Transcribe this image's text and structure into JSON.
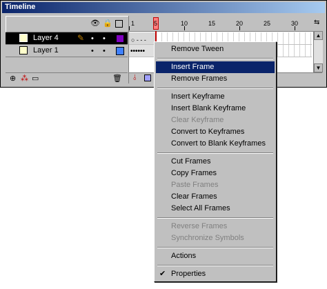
{
  "window": {
    "title": "Timeline"
  },
  "layers": [
    {
      "name": "Layer 4",
      "selected": true,
      "color": "#8000c0"
    },
    {
      "name": "Layer 1",
      "selected": false,
      "color": "#4080ff"
    }
  ],
  "ruler": {
    "labels": [
      "1",
      "5",
      "10",
      "15",
      "20",
      "25",
      "30"
    ],
    "current_frame": "5"
  },
  "context_menu": {
    "items": [
      {
        "label": "Remove Tween",
        "enabled": true
      },
      {
        "label": "Insert Frame",
        "enabled": true,
        "highlighted": true
      },
      {
        "label": "Remove Frames",
        "enabled": true
      },
      {
        "label": "Insert Keyframe",
        "enabled": true
      },
      {
        "label": "Insert Blank Keyframe",
        "enabled": true
      },
      {
        "label": "Clear Keyframe",
        "enabled": false
      },
      {
        "label": "Convert to Keyframes",
        "enabled": true
      },
      {
        "label": "Convert to Blank Keyframes",
        "enabled": true
      },
      {
        "label": "Cut Frames",
        "enabled": true
      },
      {
        "label": "Copy Frames",
        "enabled": true
      },
      {
        "label": "Paste Frames",
        "enabled": false
      },
      {
        "label": "Clear Frames",
        "enabled": true
      },
      {
        "label": "Select All Frames",
        "enabled": true
      },
      {
        "label": "Reverse Frames",
        "enabled": false
      },
      {
        "label": "Synchronize Symbols",
        "enabled": false
      },
      {
        "label": "Actions",
        "enabled": true
      },
      {
        "label": "Properties",
        "enabled": true,
        "checked": true
      }
    ]
  },
  "icons": {
    "header": [
      "eye-icon",
      "lock-icon",
      "outline-icon"
    ],
    "footer": [
      "add-layer-icon",
      "add-guide-icon",
      "add-folder-icon",
      "trash-icon"
    ]
  },
  "colors": {
    "title_bar": "#0a246a",
    "menu_highlight": "#0a246a",
    "playhead": "#ff8080"
  }
}
